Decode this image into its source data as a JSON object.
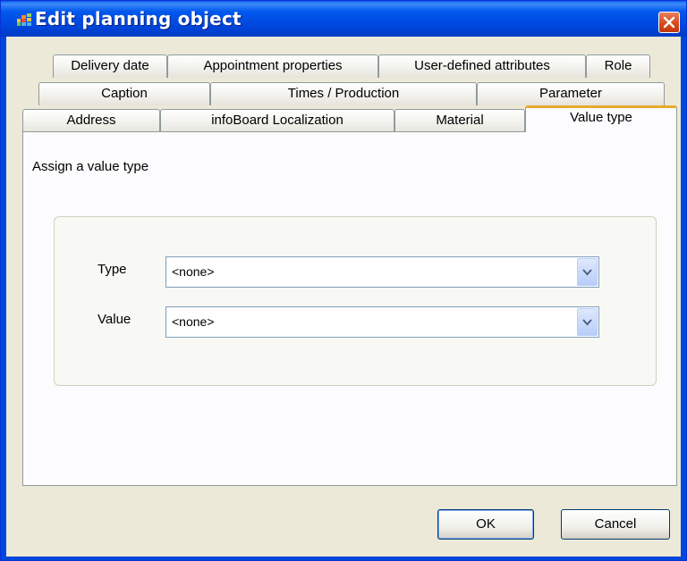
{
  "window": {
    "title": "Edit planning object",
    "app_icon": "grid-app-icon",
    "close_icon": "close-icon"
  },
  "tabs": {
    "row1": [
      "Delivery date",
      "Appointment properties",
      "User-defined attributes",
      "Role"
    ],
    "row2": [
      "Caption",
      "Times / Production",
      "Parameter"
    ],
    "row3": [
      "Address",
      "infoBoard Localization",
      "Material",
      "Value type"
    ],
    "active": "Value type"
  },
  "panel": {
    "heading": "Assign a value type",
    "fields": {
      "type_label": "Type",
      "type_value": "<none>",
      "value_label": "Value",
      "value_value": "<none>"
    }
  },
  "buttons": {
    "ok": "OK",
    "cancel": "Cancel"
  },
  "colors": {
    "titlebar": "#0058ee",
    "active_tab_highlight": "#e8a92d",
    "dialog_background": "#ece9d8"
  }
}
